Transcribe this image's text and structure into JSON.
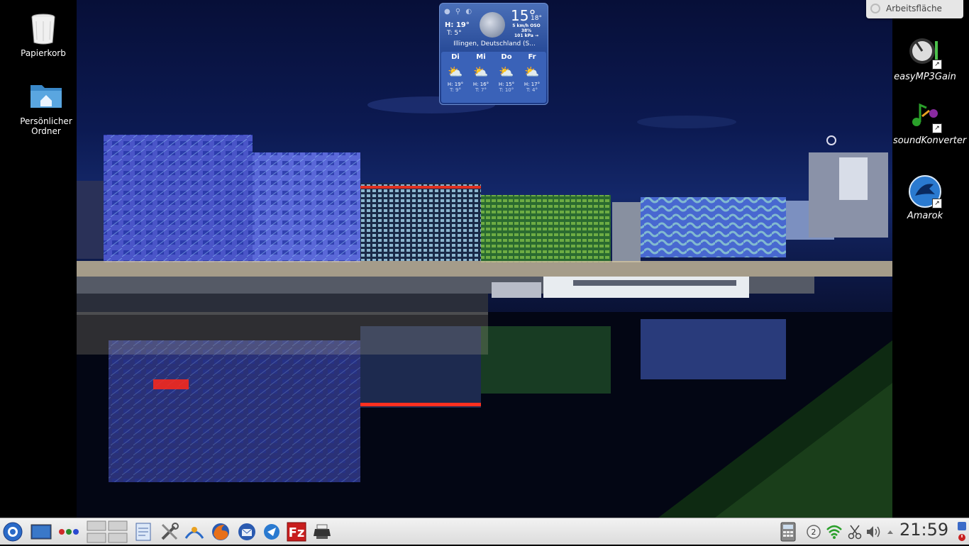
{
  "desktop": {
    "icons_left": [
      {
        "label": "Papierkorb",
        "icon": "trash-icon"
      },
      {
        "label": "Persönlicher Ordner",
        "icon": "home-folder-icon"
      }
    ],
    "icons_right": [
      {
        "label": "easyMP3Gain",
        "icon": "easymp3gain-icon"
      },
      {
        "label": "soundKonverter",
        "icon": "soundkonverter-icon"
      },
      {
        "label": "Amarok",
        "icon": "amarok-icon"
      }
    ]
  },
  "activity_button": {
    "label": "Arbeitsfläche"
  },
  "weather": {
    "high": "H: 19°",
    "low": "T: 5°",
    "current_temp": "15°",
    "feels": "18°",
    "wind": "5 km/h OSO",
    "humidity": "38%",
    "pressure": "101 kPa →",
    "location": "Illingen, Deutschland (S...",
    "forecast": [
      {
        "day": "Di",
        "high": "H: 19°",
        "low": "T: 9°"
      },
      {
        "day": "Mi",
        "high": "H: 16°",
        "low": "T: 7°"
      },
      {
        "day": "Do",
        "high": "H: 15°",
        "low": "T: 10°"
      },
      {
        "day": "Fr",
        "high": "H: 17°",
        "low": "T: 4°"
      }
    ]
  },
  "taskbar": {
    "launchers": [
      "kde-menu-icon",
      "show-desktop-icon",
      "activities-icon",
      "pager-icon",
      "notes-icon",
      "system-settings-icon",
      "network-icon",
      "firefox-icon",
      "thunderbird-icon",
      "krusader-icon",
      "filezilla-icon",
      "printer-icon"
    ],
    "tray": [
      "calculator-icon",
      "klipper-icon",
      "wifi-icon",
      "scissors-icon",
      "volume-icon",
      "tray-expand-icon"
    ],
    "clock": "21:59"
  },
  "colors": {
    "taskbar_bg": "#e2e2e2",
    "weather_bg": "#2a4d9a",
    "desktop_bg": "#000000"
  }
}
